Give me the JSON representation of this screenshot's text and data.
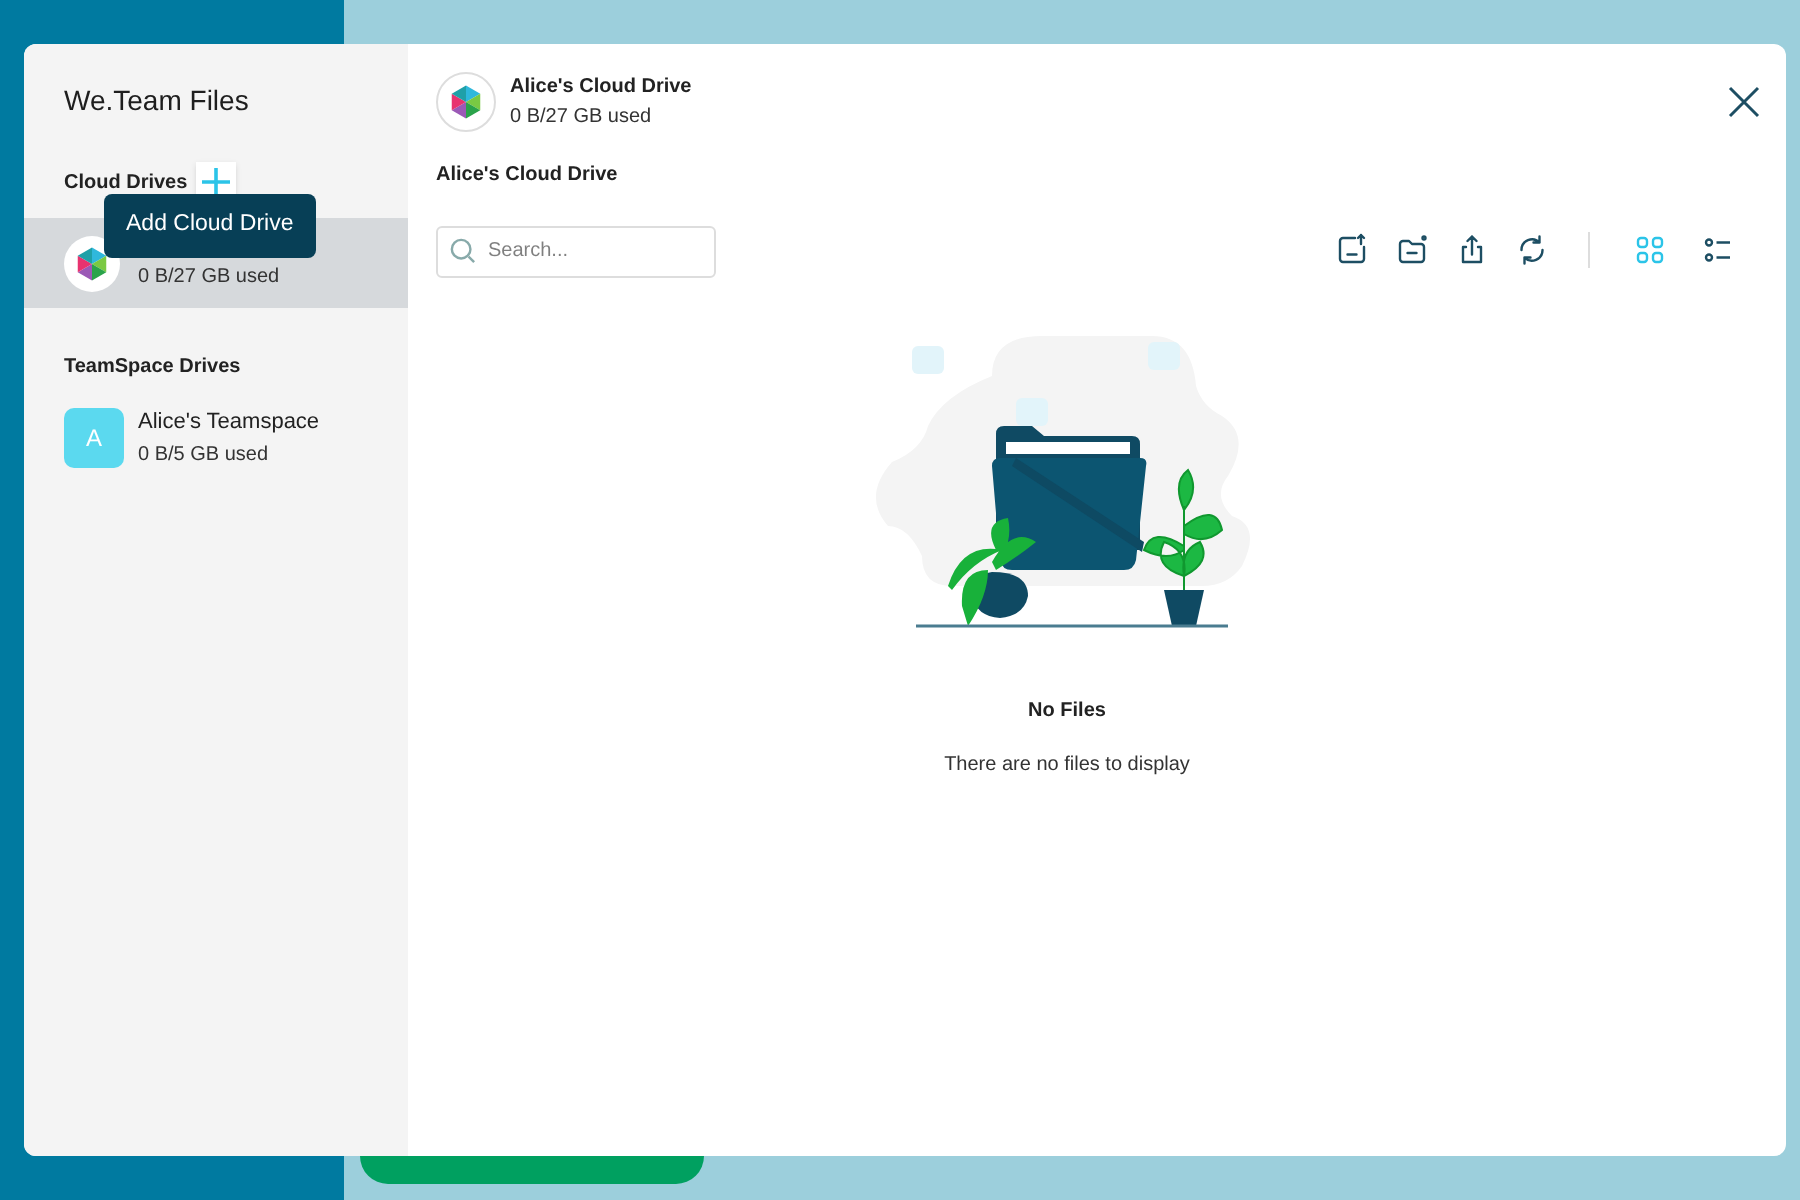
{
  "dialog": {
    "title": "We.Team Files",
    "cloud_drives": {
      "heading": "Cloud Drives",
      "tooltip": "Add Cloud Drive",
      "items": [
        {
          "kind": "cloud",
          "usage": "0 B/27 GB used",
          "selected": true
        }
      ]
    },
    "teamspace_drives": {
      "heading": "TeamSpace Drives",
      "items": [
        {
          "kind": "letter",
          "letter": "A",
          "name": "Alice's Teamspace",
          "usage": "0 B/5 GB used",
          "selected": false
        }
      ]
    },
    "header": {
      "name": "Alice's Cloud Drive",
      "usage": "0 B/27 GB used"
    },
    "breadcrumb": "Alice's Cloud Drive",
    "search": {
      "placeholder": "Search..."
    },
    "views": [
      {
        "kind": "grid",
        "selected": true
      },
      {
        "kind": "list",
        "selected": false
      }
    ],
    "empty": {
      "title": "No Files",
      "message": "There are no files to display"
    }
  }
}
